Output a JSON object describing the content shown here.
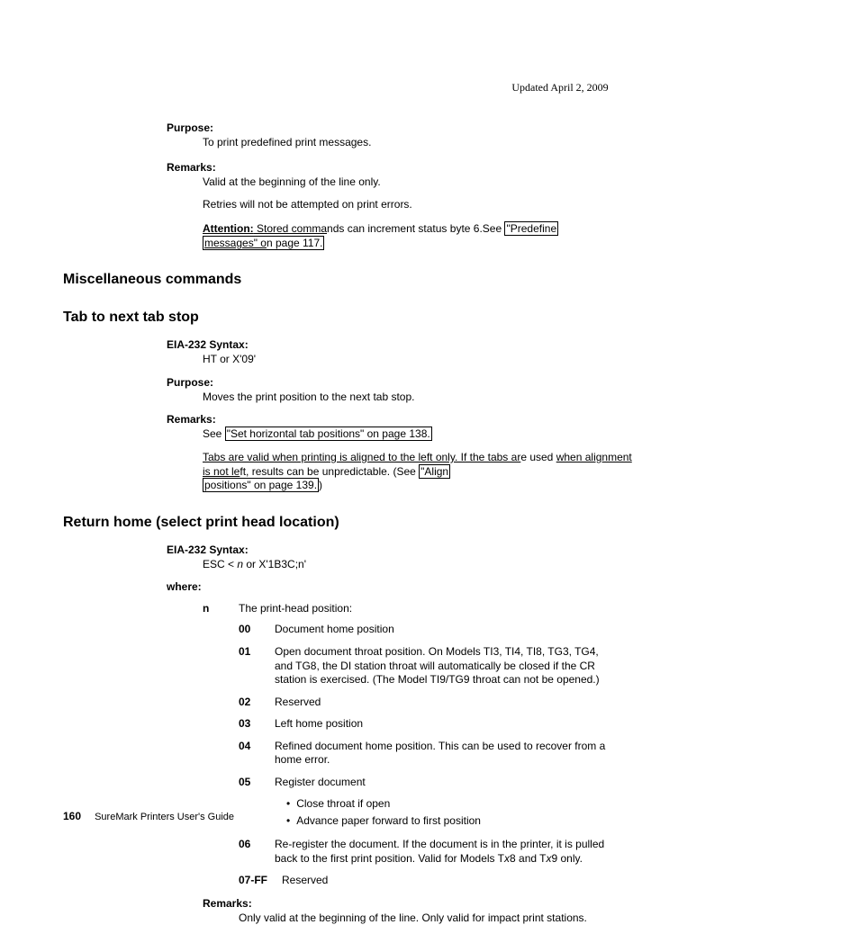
{
  "updated": "Updated April 2, 2009",
  "sec0": {
    "purpose_label": "Purpose:",
    "purpose_text": "To print predefined print messages.",
    "remarks_label": "Remarks:",
    "remarks_1": "Valid at the beginning of the line only.",
    "remarks_2": "Retries will not be attempted on print errors.",
    "att_label": "Attention:",
    "att_stored": " Stored comma",
    "att_rest": "nds can increment status byte 6.See ",
    "att_link1": "\"Predefine",
    "att_link2_full": "messages\" on page 117.",
    "att_msgs_under": "messages\" o",
    "att_n_plain": "n page 117."
  },
  "h_misc": "Miscellaneous commands",
  "h_tab": "Tab to next tab stop",
  "sec1": {
    "syntax_label": "EIA-232 Syntax:",
    "syntax_val": "HT or X'09'",
    "purpose_label": "Purpose:",
    "purpose_text": "Moves the print position to the next tab stop.",
    "remarks_label": "Remarks:",
    "see_text": "See ",
    "see_link": "\"Set horizontal tab positions\" on page 138.",
    "tabs_1": "Tabs are valid when printing is aligned to the left only. If the tabs ar",
    "tabs_e_used": "e used",
    "tabs_2_under": "when alignment is not le",
    "tabs_2_rest": "ft, results can be unpredictable. (See ",
    "tabs_link": "\"Align",
    "tabs_link2": "positions\" on page 139.",
    "tabs_close": ")"
  },
  "h_return": "Return home (select print head location)",
  "sec2": {
    "syntax_label": "EIA-232 Syntax:",
    "syntax_pre": "ESC < ",
    "syntax_n": "n",
    "syntax_post": " or X'1B3C;n'",
    "where_label": "where:",
    "n_label": "n",
    "n_desc": "The print-head position:",
    "r00_l": "00",
    "r00_v": "Document home position",
    "r01_l": "01",
    "r01_v": "Open document throat position. On Models TI3, TI4, TI8, TG3, TG4, and TG8, the DI station throat will automatically be closed if the CR station is exercised. (The Model TI9/TG9 throat can not be opened.)",
    "r02_l": "02",
    "r02_v": "Reserved",
    "r03_l": "03",
    "r03_v": "Left home position",
    "r04_l": "04",
    "r04_v": "Refined document home position. This can be used to recover from a home error.",
    "r05_l": "05",
    "r05_v": "Register document",
    "r05_b1": "Close throat if open",
    "r05_b2": "Advance paper forward to first position",
    "r06_l": "06",
    "r06_pre": "Re-register the document. If the document is in the printer, it is pulled back to the first print position. Valid for Models T",
    "r06_x1": "x",
    "r06_mid": "8 and T",
    "r06_x2": "x",
    "r06_post": "9 only.",
    "r07_l": "07-FF",
    "r07_v": "Reserved",
    "remarks_label": "Remarks:",
    "remarks_text": "Only valid at the beginning of the line. Only valid for impact print stations."
  },
  "footer": {
    "page": "160",
    "title": "SureMark Printers User's Guide"
  }
}
